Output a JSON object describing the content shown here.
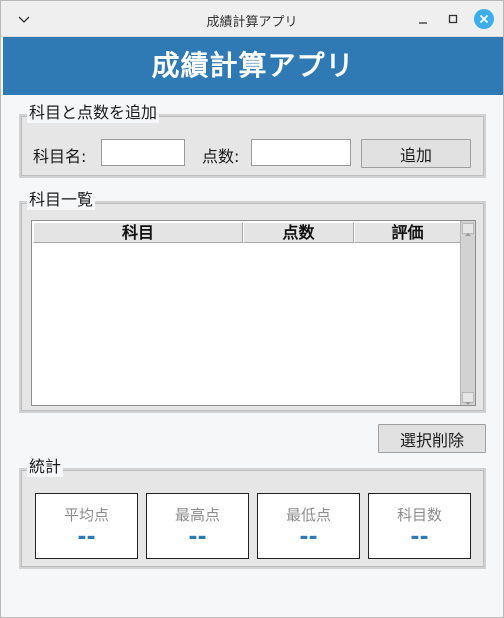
{
  "window": {
    "title": "成績計算アプリ"
  },
  "header": {
    "title": "成績計算アプリ",
    "color": "#2f79b5"
  },
  "add_section": {
    "legend": "科目と点数を追加",
    "subject_label": "科目名:",
    "subject_value": "",
    "score_label": "点数:",
    "score_value": "",
    "add_button": "追加"
  },
  "list_section": {
    "legend": "科目一覧",
    "columns": [
      "科目",
      "点数",
      "評価"
    ],
    "rows": []
  },
  "delete_button": "選択削除",
  "stats_section": {
    "legend": "統計",
    "cards": [
      {
        "label": "平均点",
        "value": "--"
      },
      {
        "label": "最高点",
        "value": "--"
      },
      {
        "label": "最低点",
        "value": "--"
      },
      {
        "label": "科目数",
        "value": "--"
      }
    ]
  },
  "icons": {
    "menu": "chevron-down-icon",
    "minimize": "minimize-icon",
    "maximize": "maximize-icon",
    "close": "close-icon"
  }
}
